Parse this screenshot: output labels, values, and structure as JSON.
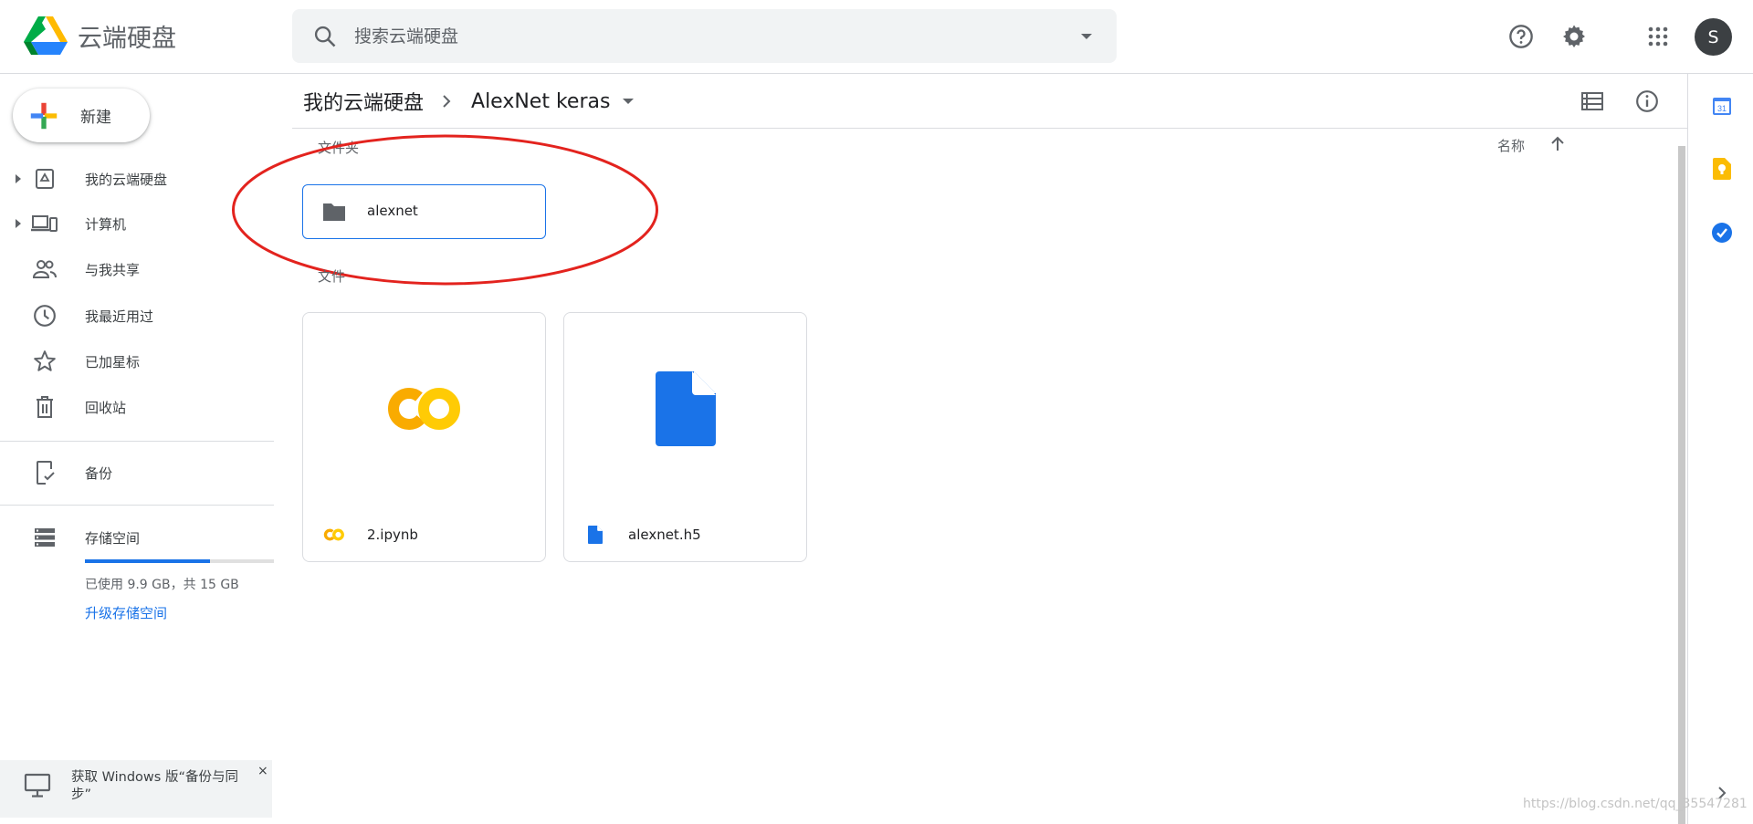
{
  "header": {
    "app_name": "云端硬盘",
    "search_placeholder": "搜索云端硬盘",
    "avatar_letter": "S",
    "logo_colors": [
      "#0066da",
      "#00ac47",
      "#ea4335",
      "#00832d",
      "#2684fc",
      "#ffba00"
    ]
  },
  "sidebar": {
    "new_label": "新建",
    "items": [
      {
        "label": "我的云端硬盘",
        "icon": "my-drive-icon",
        "expandable": true
      },
      {
        "label": "计算机",
        "icon": "computers-icon",
        "expandable": true
      },
      {
        "label": "与我共享",
        "icon": "shared-icon",
        "expandable": false
      },
      {
        "label": "我最近用过",
        "icon": "recent-icon",
        "expandable": false
      },
      {
        "label": "已加星标",
        "icon": "star-icon",
        "expandable": false
      },
      {
        "label": "回收站",
        "icon": "trash-icon",
        "expandable": false
      }
    ],
    "backup_label": "备份",
    "storage": {
      "label": "存储空间",
      "used_fraction": 0.66,
      "usage_text": "已使用 9.9 GB，共 15 GB",
      "upgrade_label": "升级存储空间"
    },
    "promo": {
      "text": "获取 Windows 版“备份与同步”",
      "close": "×"
    }
  },
  "main": {
    "breadcrumb": {
      "root": "我的云端硬盘",
      "current": "AlexNet keras"
    },
    "sort_label": "名称",
    "folders_label": "文件夹",
    "files_label": "文件",
    "folders": [
      {
        "name": "alexnet"
      }
    ],
    "files": [
      {
        "name": "2.ipynb",
        "type": "colab"
      },
      {
        "name": "alexnet.h5",
        "type": "file"
      }
    ]
  },
  "colors": {
    "accent": "#1a73e8",
    "annotation": "#e3231e",
    "colab_orange": "#f9ab00",
    "colab_yellow": "#ffcb05"
  },
  "watermark": "https://blog.csdn.net/qq_35547281"
}
